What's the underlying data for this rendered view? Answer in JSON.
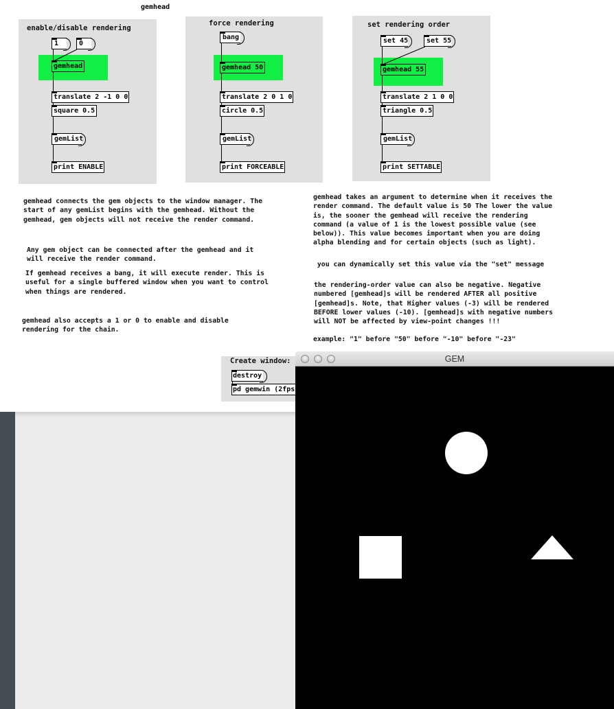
{
  "patch": {
    "title": "gemhead",
    "panels": {
      "enable": {
        "label": "enable/disable rendering",
        "toggle_1": "1",
        "toggle_0": "0",
        "gemhead": "gemhead",
        "translate": "translate 2 -1 0 0",
        "shape": "square 0.5",
        "gemlist": "gemList",
        "print": "print ENABLE"
      },
      "force": {
        "label": "force rendering",
        "bang": "bang",
        "gemhead": "gemhead 50",
        "translate": "translate 2 0 1 0",
        "shape": "circle 0.5",
        "gemlist": "gemList",
        "print": "print FORCEABLE"
      },
      "order": {
        "label": "set rendering order",
        "set_a": "set 45",
        "set_b": "set 55",
        "gemhead": "gemhead 55",
        "translate": "translate 2 1 0 0",
        "shape": "triangle 0.5",
        "gemlist": "gemList",
        "print": "print SETTABLE"
      }
    },
    "left_text": {
      "p1": "gemhead connects the gem objects to the window manager. The\nstart of any gemList begins with the gemhead. Without the\ngemhead, gem objects will not receive the render command.",
      "p2": "Any gem object can be connected after the gemhead and it\nwill receive the render command.",
      "p3": "If gemhead receives a bang, it will execute render. This is\nuseful for a single buffered window when you want to control\nwhen things are rendered.",
      "p4": "gemhead also accepts a 1 or 0 to enable and disable\nrendering for the chain."
    },
    "right_text": {
      "p1": "gemhead takes an argument to determine when it receives the\nrender command. The default value is 50 The lower the value\nis, the sooner the gemhead will receive the rendering\ncommand (a value of 1 is the lowest possible value (see\nbelow)). This value becomes important when you are doing\nalpha blending and for certain objects (such as light).",
      "p2": " you can dynamically set this value via the \"set\" message",
      "p3": "the rendering-order value can also be negative. Negative\nnumbered [gemhead]s will be rendered AFTER all positive\n[gemhead]s. Note, that Higher values (-3) will be rendered\nBEFORE lower values (-10). [gemhead]s with negative numbers\nwill NOT be affected by view-point changes !!!",
      "p4": "example: \"1\" before \"50\" before \"-10\" before \"-23\""
    },
    "create_window": {
      "label": "Create window:",
      "destroy": "destroy",
      "gemwin": "pd gemwin (2fps"
    }
  },
  "gem_window": {
    "title": "GEM",
    "shapes": [
      "circle",
      "square",
      "triangle"
    ],
    "colors": {
      "background": "#000000",
      "shape": "#ffffff",
      "patch_green": "#11ee44",
      "panel": "#e0e0e0"
    }
  }
}
